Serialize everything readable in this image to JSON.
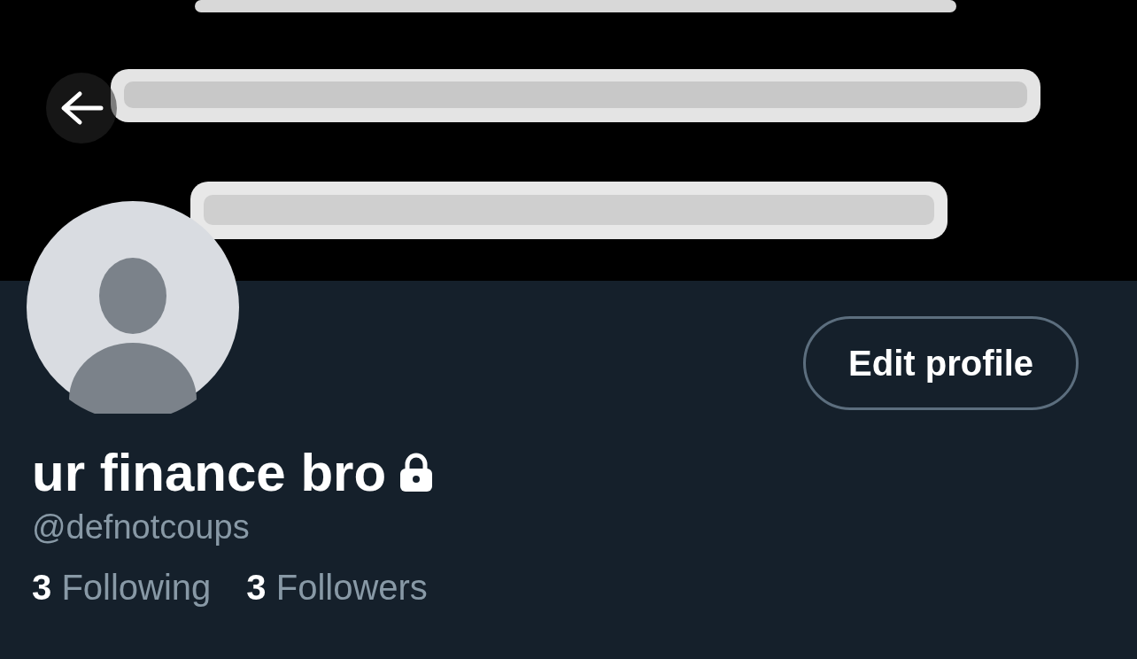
{
  "edit_button": "Edit profile",
  "profile": {
    "name": "ur finance bro",
    "locked": true,
    "handle": "@defnotcoups"
  },
  "stats": [
    {
      "count": "3",
      "label": "Following"
    },
    {
      "count": "3",
      "label": "Followers"
    }
  ]
}
